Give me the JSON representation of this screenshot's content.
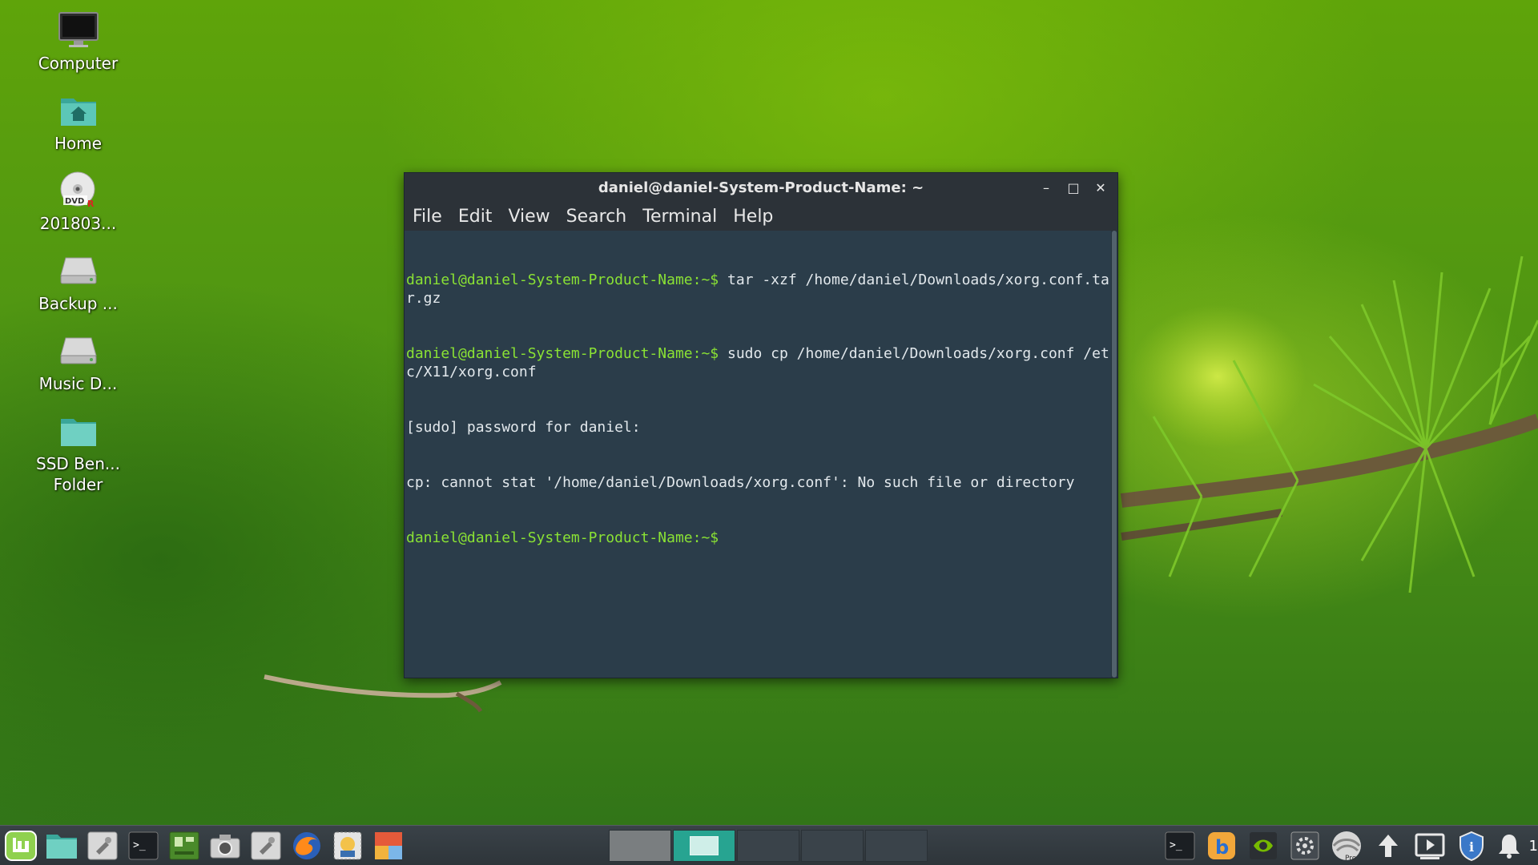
{
  "desktop": {
    "icons": [
      {
        "label": "Computer",
        "icon": "monitor-icon"
      },
      {
        "label": "Home",
        "icon": "home-folder-icon"
      },
      {
        "label": "201803...",
        "icon": "dvd-icon"
      },
      {
        "label": "Backup ...",
        "icon": "drive-icon"
      },
      {
        "label": "Music D...",
        "icon": "drive-icon"
      },
      {
        "label": "SSD Ben... Folder",
        "icon": "folder-icon"
      }
    ]
  },
  "terminal": {
    "title": "daniel@daniel-System-Product-Name: ~",
    "controls": {
      "minimize": "–",
      "maximize": "□",
      "close": "✕"
    },
    "menu": [
      "File",
      "Edit",
      "View",
      "Search",
      "Terminal",
      "Help"
    ],
    "lines": [
      {
        "prompt": "daniel@daniel-System-Product-Name:~$",
        "text": " tar -xzf /home/daniel/Downloads/xorg.conf.tar.gz"
      },
      {
        "prompt": "daniel@daniel-System-Product-Name:~$",
        "text": " sudo cp /home/daniel/Downloads/xorg.conf /etc/X11/xorg.conf"
      },
      {
        "prompt": "",
        "text": "[sudo] password for daniel:"
      },
      {
        "prompt": "",
        "text": "cp: cannot stat '/home/daniel/Downloads/xorg.conf': No such file or directory"
      },
      {
        "prompt": "daniel@daniel-System-Product-Name:~$",
        "text": ""
      }
    ]
  },
  "taskbar": {
    "launchers": [
      "mint-menu-icon",
      "files-icon",
      "settings-icon",
      "terminal-icon",
      "system-monitor-icon",
      "camera-icon",
      "settings-icon",
      "firefox-icon",
      "image-viewer-icon",
      "paint-icon"
    ],
    "workspaces": 5,
    "active_workspace": 1,
    "tray": [
      "terminal-icon",
      "bluetooth-icon",
      "nvidia-icon",
      "system-settings-icon",
      "network-icon",
      "update-arrow-icon",
      "media-icon",
      "info-shield-icon",
      "notification-bell-icon"
    ],
    "tray_text": "1"
  },
  "colors": {
    "prompt": "#8ae234",
    "terminal_bg": "#2b3d4a",
    "workspace_active": "#27a491"
  }
}
